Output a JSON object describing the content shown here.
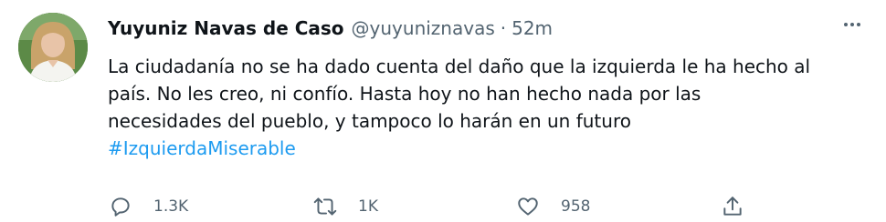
{
  "tweet": {
    "display_name": "Yuyuniz Navas de Caso",
    "handle": "@yuyuniznavas",
    "separator": "·",
    "time": "52m",
    "text_lines": [
      "La ciudadanía no se ha dado cuenta del daño que la izquierda le ha hecho al",
      "país. No les creo, ni confío. Hasta hoy no han hecho nada por las",
      "necesidades del pueblo, y tampoco lo harán en un futuro"
    ],
    "hashtag": "#IzquierdaMiserable",
    "actions": {
      "reply_count": "1.3K",
      "retweet_count": "1K",
      "like_count": "958"
    },
    "icons": {
      "more": "more-horizontal-icon",
      "reply": "reply-icon",
      "retweet": "retweet-icon",
      "like": "heart-icon",
      "share": "share-icon"
    },
    "colors": {
      "text": "#0f1419",
      "secondary": "#536471",
      "link": "#1d9bf0"
    }
  }
}
